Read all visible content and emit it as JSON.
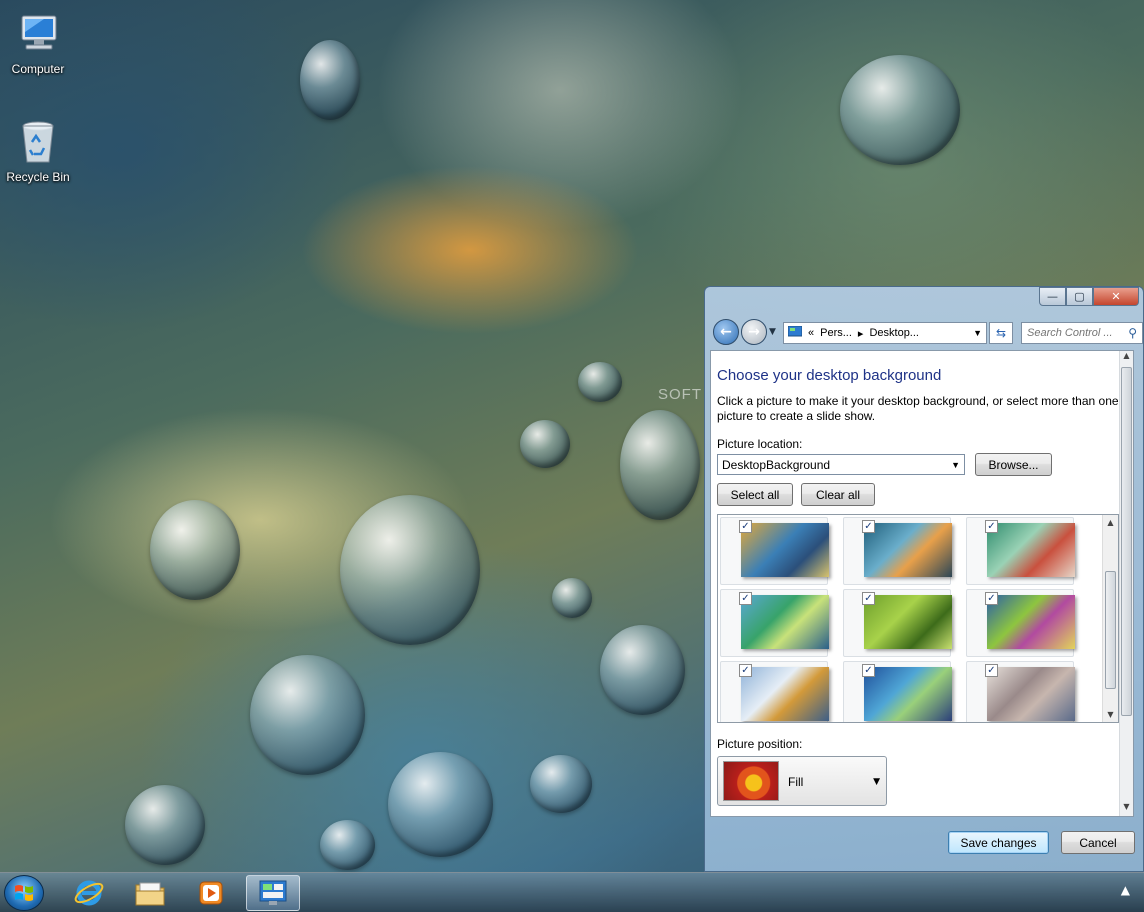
{
  "desktop": {
    "icons": [
      {
        "label": "Computer"
      },
      {
        "label": "Recycle Bin"
      }
    ],
    "watermark": "SOFT"
  },
  "window": {
    "caption": {
      "minimize": "—",
      "maximize": "▢",
      "close": "✕"
    },
    "nav": {
      "breadcrumb": [
        "«",
        "Pers...",
        "▸",
        "Desktop..."
      ],
      "search_placeholder": "Search Control ..."
    },
    "heading": "Choose your desktop background",
    "description": "Click a picture to make it your desktop background, or select more than one picture to create a slide show.",
    "picture_location_label": "Picture location:",
    "picture_location_value": "DesktopBackground",
    "browse_label": "Browse...",
    "select_all_label": "Select all",
    "clear_all_label": "Clear all",
    "thumbnails_checked": [
      true,
      true,
      true,
      true,
      true,
      true,
      true,
      true,
      true
    ],
    "picture_position_label": "Picture position:",
    "picture_position_value": "Fill",
    "save_label": "Save changes",
    "cancel_label": "Cancel"
  },
  "colors": {
    "heading": "#1e3287",
    "accent": "#3c7fb1"
  }
}
